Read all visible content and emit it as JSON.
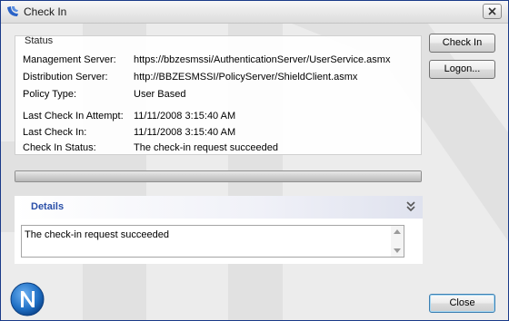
{
  "window": {
    "title": "Check In",
    "close_label": "Close window"
  },
  "status": {
    "legend": "Status",
    "rows": [
      {
        "label": "Management Server:",
        "value": "https://bbzesmssi/AuthenticationServer/UserService.asmx"
      },
      {
        "label": "Distribution Server:",
        "value": "http://BBZESMSSI/PolicyServer/ShieldClient.asmx"
      },
      {
        "label": "Policy Type:",
        "value": "User Based"
      },
      {
        "label": "Last Check In Attempt:",
        "value": "11/11/2008 3:15:40 AM"
      },
      {
        "label": "Last Check In:",
        "value": "11/11/2008 3:15:40 AM"
      },
      {
        "label": "Check In Status:",
        "value": "The check-in request succeeded"
      }
    ]
  },
  "buttons": {
    "check_in": "Check In",
    "logon": "Logon...",
    "close": "Close"
  },
  "progress": {
    "fraction": 1.0
  },
  "details": {
    "title": "Details",
    "text": "The check-in request succeeded"
  },
  "colors": {
    "title_border": "#1a3a88",
    "details_title": "#2a4fa8",
    "logo": "#1f6fc4"
  },
  "icons": {
    "title_icon": "app-check-icon",
    "close_icon": "close-icon",
    "collapse_icon": "chevron-double-down-icon",
    "logo": "n-logo-icon"
  }
}
